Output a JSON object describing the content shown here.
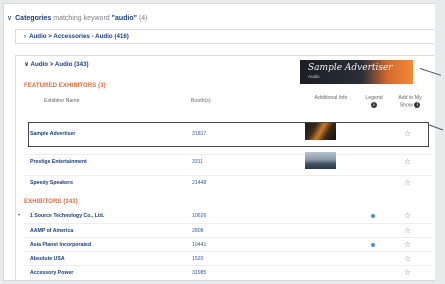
{
  "category_header": {
    "prefix": "Categories",
    "matching": " matching keyword ",
    "keyword": "\"audio\"",
    "count": "(4)"
  },
  "subcategories": [
    {
      "label": "Audio > Accessories - Audio (416)",
      "expanded": false
    },
    {
      "label": "Audio > Audio (343)",
      "expanded": true
    }
  ],
  "banner": {
    "title": "Sample Advertiser",
    "tagline": "Audio"
  },
  "featured": {
    "title": "FEATURED EXHIBITORS (3)",
    "columns": {
      "name": "Exhibitor Name",
      "booth": "Booth(s)",
      "additional": "Additional Info",
      "legend": "Legend",
      "add": "Add to My Show"
    },
    "rows": [
      {
        "name": "Sample Advertiser",
        "booth": "31817",
        "thumb": "guitar-thumb"
      },
      {
        "name": "Prestige Entertainment",
        "booth": "3311",
        "thumb": "landscape-thumb"
      },
      {
        "name": "Speedy Speakers",
        "booth": "21448",
        "thumb": ""
      }
    ]
  },
  "exhibitors": {
    "title": "EXHIBITORS (343)",
    "rows": [
      {
        "name": "1 Source Technology Co., Ltd.",
        "booth": "10626",
        "bullet": true,
        "legend": true
      },
      {
        "name": "AAMP of America",
        "booth": "2808",
        "bullet": false,
        "legend": false
      },
      {
        "name": "Asia Planet Incorporated",
        "booth": "10441",
        "bullet": false,
        "legend": true
      },
      {
        "name": "Absolute USA",
        "booth": "1520",
        "bullet": false,
        "legend": false
      },
      {
        "name": "Accessory Power",
        "booth": "31985",
        "bullet": false,
        "legend": false
      }
    ]
  },
  "colors": {
    "link": "#1c3f7a",
    "section": "#e06a3a",
    "legend_dot": "#4a90d9"
  }
}
